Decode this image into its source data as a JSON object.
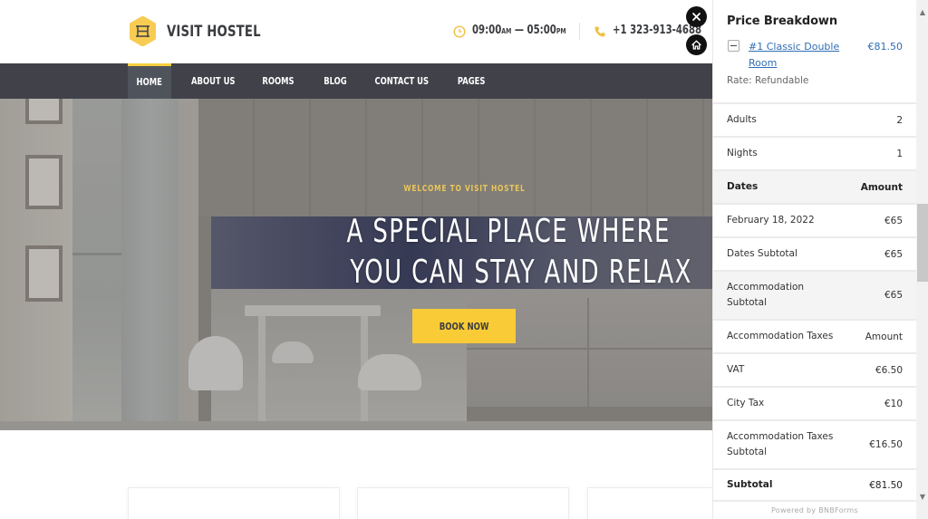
{
  "site": {
    "brand": "VISIT HOSTEL",
    "logo_icon": "hostel-h-icon",
    "hours": {
      "icon": "clock-icon",
      "open": "09:00",
      "open_suffix": "AM",
      "dash": " — ",
      "close": "05:00",
      "close_suffix": "PM"
    },
    "phone": {
      "icon": "phone-icon",
      "number": "+1 323-913-4688"
    }
  },
  "nav": {
    "items": [
      {
        "label": "HOME",
        "active": true
      },
      {
        "label": "ABOUT US",
        "active": false
      },
      {
        "label": "ROOMS",
        "active": false
      },
      {
        "label": "BLOG",
        "active": false
      },
      {
        "label": "CONTACT US",
        "active": false
      },
      {
        "label": "PAGES",
        "active": false
      }
    ]
  },
  "hero": {
    "tagline": "WELCOME TO VISIT HOSTEL",
    "title_line1": "A SPECIAL PLACE WHERE",
    "title_line2": "YOU CAN STAY AND RELAX",
    "cta_label": "BOOK NOW"
  },
  "floating_buttons": {
    "close_icon": "close-icon",
    "home_icon": "home-icon"
  },
  "price_breakdown": {
    "title": "Price Breakdown",
    "toggle_icon": "minus-icon",
    "room_name": "#1 Classic Double Room",
    "room_price": "€81.50",
    "rate": "Rate: Refundable",
    "rows": [
      {
        "label": "Adults",
        "value": "2",
        "style": "normal"
      },
      {
        "label": "Nights",
        "value": "1",
        "style": "normal"
      },
      {
        "label": "Dates",
        "value": "Amount",
        "style": "header"
      },
      {
        "label": "February 18, 2022",
        "value": "€65",
        "style": "normal"
      },
      {
        "label": "Dates Subtotal",
        "value": "€65",
        "style": "normal"
      },
      {
        "label": "Accommodation Subtotal",
        "value": "€65",
        "style": "shaded"
      },
      {
        "label": "Accommodation Taxes",
        "value": "Amount",
        "style": "normal"
      },
      {
        "label": "VAT",
        "value": "€6.50",
        "style": "normal"
      },
      {
        "label": "City Tax",
        "value": "€10",
        "style": "normal"
      },
      {
        "label": "Accommodation Taxes Subtotal",
        "value": "€16.50",
        "style": "normal"
      },
      {
        "label": "Subtotal",
        "value": "€81.50",
        "style": "bold"
      }
    ],
    "powered_by": "Powered by BNBForms"
  },
  "colors": {
    "accent": "#f9cb36",
    "nav_bg": "#414249",
    "link": "#2f6db5"
  }
}
